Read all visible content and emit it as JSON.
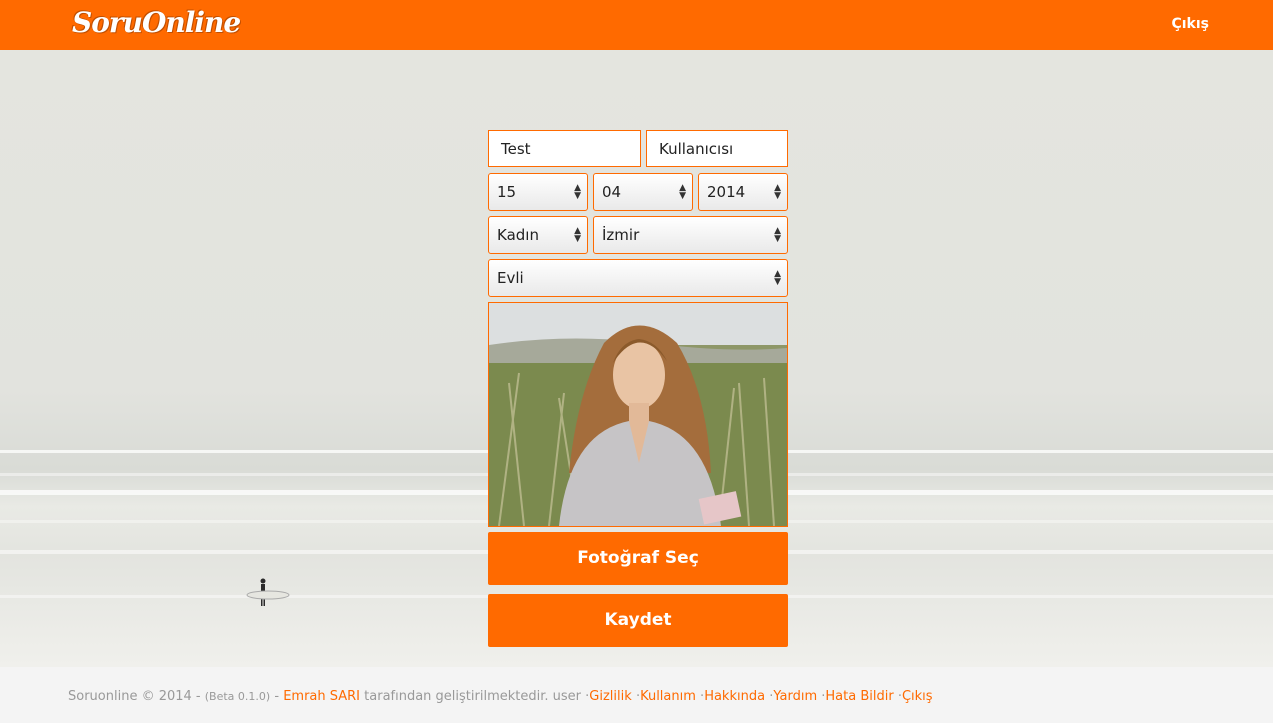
{
  "header": {
    "logo": "SoruOnline",
    "exit_link": "Çıkış"
  },
  "form": {
    "first_name": "Test",
    "last_name": "Kullanıcısı",
    "birth_day": "15",
    "birth_month": "04",
    "birth_year": "2014",
    "gender": "Kadın",
    "city": "İzmir",
    "marital_status": "Evli",
    "choose_photo_label": "Fotoğraf Seç",
    "save_label": "Kaydet"
  },
  "footer": {
    "copyright": "Soruonline © 2014 -",
    "version": "(Beta 0.1.0)",
    "dash": "-",
    "author": "Emrah SARI",
    "dev_text": "tarafından geliştirilmektedir.",
    "user": "user",
    "sep": "·",
    "links": [
      "Gizlilik",
      "Kullanım",
      "Hakkında",
      "Yardım",
      "Hata Bildir",
      "Çıkış"
    ]
  },
  "colors": {
    "accent": "#ff6a00",
    "footer_bg": "#f4f4f4"
  }
}
